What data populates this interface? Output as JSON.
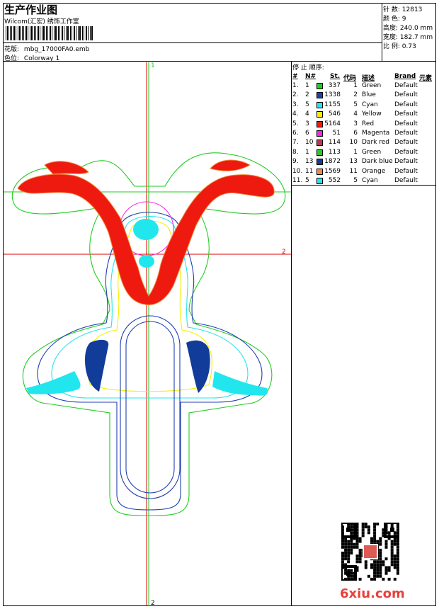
{
  "header": {
    "title": "生产作业图",
    "subtitle": "Wilcom(汇宏) 绣饰工作室",
    "design_label": "花版:",
    "design_value": "mbg_17000FA0.emb",
    "colorway_label": "色位:",
    "colorway_value": "Colorway 1"
  },
  "stats": [
    {
      "label": "针 数:",
      "value": "12813"
    },
    {
      "label": "颜 色:",
      "value": "9"
    },
    {
      "label": "高度:",
      "value": "240.0 mm"
    },
    {
      "label": "宽度:",
      "value": "182.7 mm"
    },
    {
      "label": "比 例:",
      "value": "0.73"
    }
  ],
  "stop_sequence": {
    "title": "停 止 顺序:",
    "headers": {
      "num": "#",
      "n": "N#",
      "st": "St.",
      "code": "代码",
      "desc": "描述",
      "brand": "Brand",
      "element": "元素"
    },
    "rows": [
      {
        "num": "1.",
        "n": "1",
        "color": "#22cc22",
        "st": "337",
        "code": "1",
        "desc": "Green",
        "brand": "Default"
      },
      {
        "num": "2.",
        "n": "2",
        "color": "#1f3fb0",
        "st": "1338",
        "code": "2",
        "desc": "Blue",
        "brand": "Default"
      },
      {
        "num": "3.",
        "n": "5",
        "color": "#22e6ee",
        "st": "1155",
        "code": "5",
        "desc": "Cyan",
        "brand": "Default"
      },
      {
        "num": "4.",
        "n": "4",
        "color": "#f5f000",
        "st": "546",
        "code": "4",
        "desc": "Yellow",
        "brand": "Default"
      },
      {
        "num": "5.",
        "n": "3",
        "color": "#ee1a10",
        "st": "5164",
        "code": "3",
        "desc": "Red",
        "brand": "Default"
      },
      {
        "num": "6.",
        "n": "6",
        "color": "#ff22ee",
        "st": "51",
        "code": "6",
        "desc": "Magenta",
        "brand": "Default"
      },
      {
        "num": "7.",
        "n": "10",
        "color": "#b8385a",
        "st": "114",
        "code": "10",
        "desc": "Dark red",
        "brand": "Default"
      },
      {
        "num": "8.",
        "n": "1",
        "color": "#22cc22",
        "st": "113",
        "code": "1",
        "desc": "Green",
        "brand": "Default"
      },
      {
        "num": "9.",
        "n": "13",
        "color": "#123c9a",
        "st": "1872",
        "code": "13",
        "desc": "Dark blue",
        "brand": "Default"
      },
      {
        "num": "10.",
        "n": "11",
        "color": "#f08a3a",
        "st": "1569",
        "code": "11",
        "desc": "Orange",
        "brand": "Default"
      },
      {
        "num": "11.",
        "n": "5",
        "color": "#22e6ee",
        "st": "552",
        "code": "5",
        "desc": "Cyan",
        "brand": "Default"
      }
    ]
  },
  "axes": {
    "v_top": "1",
    "v_bottom": "2",
    "h_right": "2"
  },
  "watermark": {
    "logo_text": "6xiu.com",
    "qr_icon": "qr-code-icon"
  }
}
